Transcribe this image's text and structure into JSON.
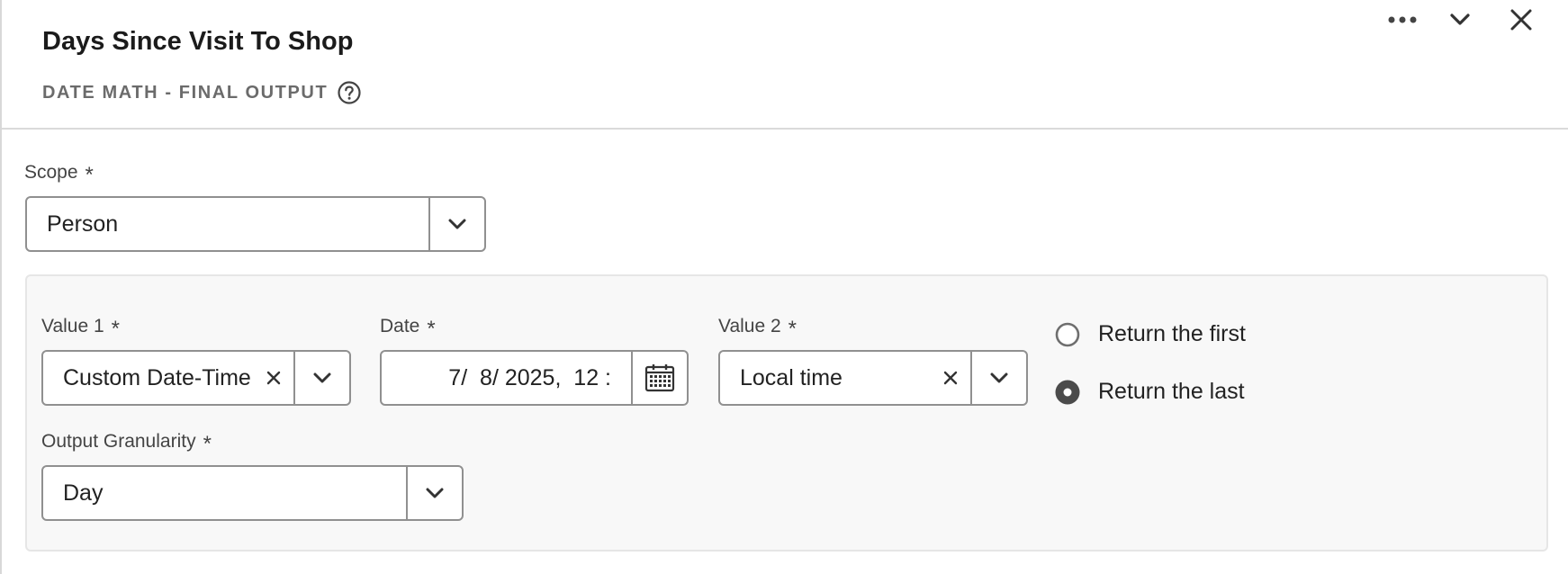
{
  "header": {
    "title": "Days Since Visit To Shop",
    "subtitle": "DATE MATH - FINAL OUTPUT",
    "icons": {
      "help": "help-circle-icon",
      "more": "more-horizontal-icon",
      "collapse": "chevron-down-icon",
      "close": "close-icon"
    }
  },
  "scope": {
    "label": "Scope",
    "required_mark": "*",
    "value": "Person"
  },
  "value1": {
    "label": "Value 1",
    "required_mark": "*",
    "value": "Custom Date-Time"
  },
  "date": {
    "label": "Date",
    "required_mark": "*",
    "value": "7/  8/ 2025,  12 :"
  },
  "value2": {
    "label": "Value 2",
    "required_mark": "*",
    "value": "Local time"
  },
  "return_options": [
    {
      "label": "Return the first",
      "selected": false
    },
    {
      "label": "Return the last",
      "selected": true
    }
  ],
  "granularity": {
    "label": "Output Granularity",
    "required_mark": "*",
    "value": "Day"
  },
  "colors": {
    "border": "#909090",
    "group_bg": "#f8f8f8",
    "text": "#222222",
    "subtle_text": "#6b6b6b"
  }
}
